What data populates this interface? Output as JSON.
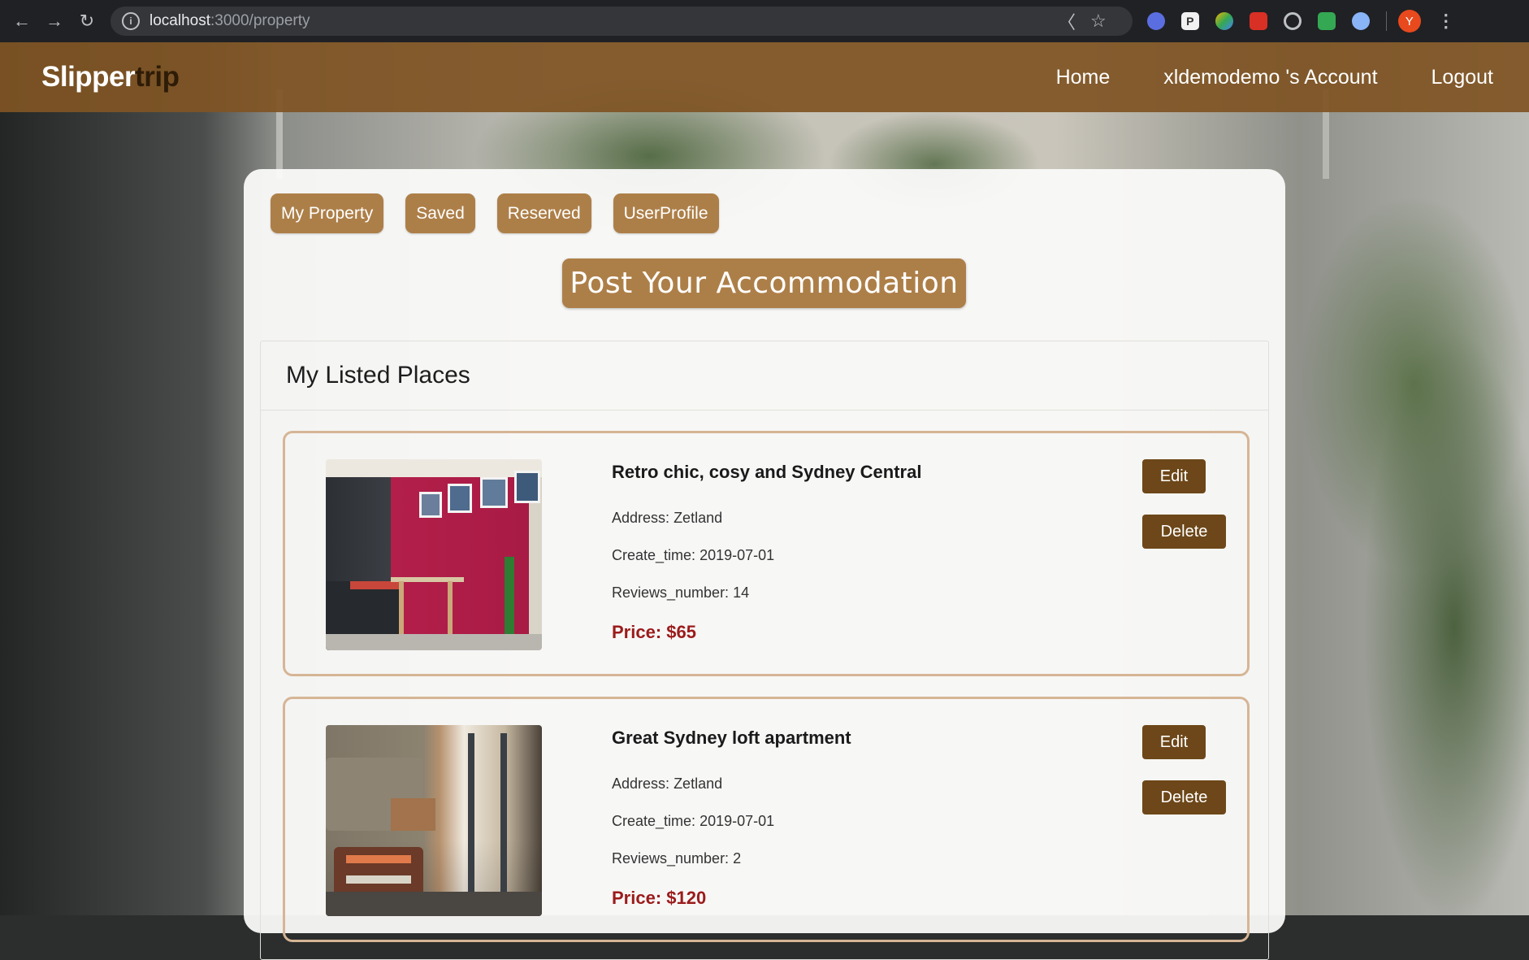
{
  "browser": {
    "url_host": "localhost",
    "url_path": ":3000/property",
    "ext_p_label": "P",
    "avatar_letter": "Y"
  },
  "navbar": {
    "logo_part1": "Slipper",
    "logo_part2": "trip",
    "links": [
      {
        "label": "Home"
      },
      {
        "label": "xldemodemo 's Account"
      },
      {
        "label": "Logout"
      }
    ]
  },
  "tabs": [
    {
      "label": "My Property"
    },
    {
      "label": "Saved"
    },
    {
      "label": "Reserved"
    },
    {
      "label": "UserProfile"
    }
  ],
  "post_button": "Post Your Accommodation",
  "listing": {
    "header": "My Listed Places",
    "field_labels": {
      "address": "Address:",
      "create_time": "Create_time:",
      "reviews": "Reviews_number:"
    },
    "edit_label": "Edit",
    "delete_label": "Delete",
    "places": [
      {
        "title": "Retro chic, cosy and Sydney Central",
        "address": "Zetland",
        "create_time": "2019-07-01",
        "reviews_number": "14",
        "price": "Price: $65"
      },
      {
        "title": "Great Sydney loft apartment",
        "address": "Zetland",
        "create_time": "2019-07-01",
        "reviews_number": "2",
        "price": "Price: $120"
      }
    ]
  },
  "colors": {
    "navbar": "#7f5424",
    "tab": "#ad7f48",
    "dark_button": "#6d4719",
    "price": "#9b1b1b",
    "card_border": "#d6b595"
  }
}
